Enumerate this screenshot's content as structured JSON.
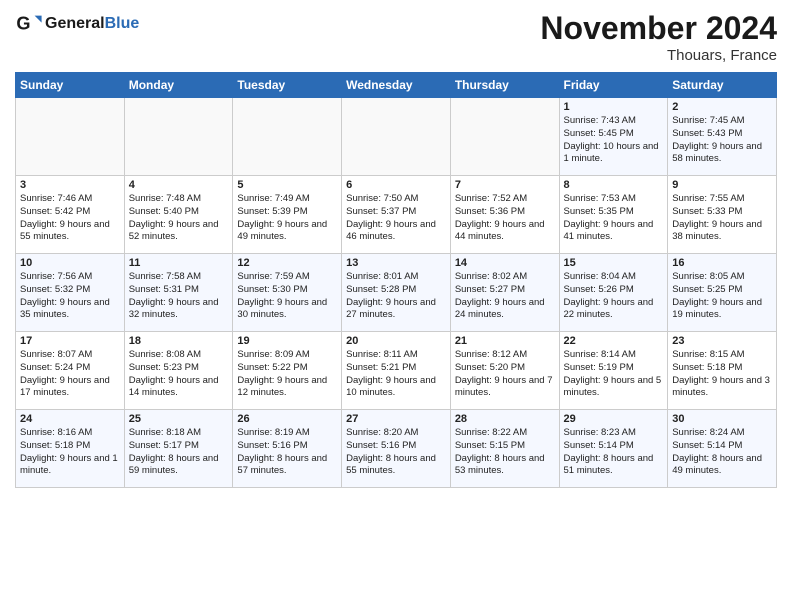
{
  "logo": {
    "text_general": "General",
    "text_blue": "Blue"
  },
  "title": "November 2024",
  "location": "Thouars, France",
  "days_of_week": [
    "Sunday",
    "Monday",
    "Tuesday",
    "Wednesday",
    "Thursday",
    "Friday",
    "Saturday"
  ],
  "weeks": [
    [
      {
        "day": "",
        "sunrise": "",
        "sunset": "",
        "daylight": ""
      },
      {
        "day": "",
        "sunrise": "",
        "sunset": "",
        "daylight": ""
      },
      {
        "day": "",
        "sunrise": "",
        "sunset": "",
        "daylight": ""
      },
      {
        "day": "",
        "sunrise": "",
        "sunset": "",
        "daylight": ""
      },
      {
        "day": "",
        "sunrise": "",
        "sunset": "",
        "daylight": ""
      },
      {
        "day": "1",
        "sunrise": "Sunrise: 7:43 AM",
        "sunset": "Sunset: 5:45 PM",
        "daylight": "Daylight: 10 hours and 1 minute."
      },
      {
        "day": "2",
        "sunrise": "Sunrise: 7:45 AM",
        "sunset": "Sunset: 5:43 PM",
        "daylight": "Daylight: 9 hours and 58 minutes."
      }
    ],
    [
      {
        "day": "3",
        "sunrise": "Sunrise: 7:46 AM",
        "sunset": "Sunset: 5:42 PM",
        "daylight": "Daylight: 9 hours and 55 minutes."
      },
      {
        "day": "4",
        "sunrise": "Sunrise: 7:48 AM",
        "sunset": "Sunset: 5:40 PM",
        "daylight": "Daylight: 9 hours and 52 minutes."
      },
      {
        "day": "5",
        "sunrise": "Sunrise: 7:49 AM",
        "sunset": "Sunset: 5:39 PM",
        "daylight": "Daylight: 9 hours and 49 minutes."
      },
      {
        "day": "6",
        "sunrise": "Sunrise: 7:50 AM",
        "sunset": "Sunset: 5:37 PM",
        "daylight": "Daylight: 9 hours and 46 minutes."
      },
      {
        "day": "7",
        "sunrise": "Sunrise: 7:52 AM",
        "sunset": "Sunset: 5:36 PM",
        "daylight": "Daylight: 9 hours and 44 minutes."
      },
      {
        "day": "8",
        "sunrise": "Sunrise: 7:53 AM",
        "sunset": "Sunset: 5:35 PM",
        "daylight": "Daylight: 9 hours and 41 minutes."
      },
      {
        "day": "9",
        "sunrise": "Sunrise: 7:55 AM",
        "sunset": "Sunset: 5:33 PM",
        "daylight": "Daylight: 9 hours and 38 minutes."
      }
    ],
    [
      {
        "day": "10",
        "sunrise": "Sunrise: 7:56 AM",
        "sunset": "Sunset: 5:32 PM",
        "daylight": "Daylight: 9 hours and 35 minutes."
      },
      {
        "day": "11",
        "sunrise": "Sunrise: 7:58 AM",
        "sunset": "Sunset: 5:31 PM",
        "daylight": "Daylight: 9 hours and 32 minutes."
      },
      {
        "day": "12",
        "sunrise": "Sunrise: 7:59 AM",
        "sunset": "Sunset: 5:30 PM",
        "daylight": "Daylight: 9 hours and 30 minutes."
      },
      {
        "day": "13",
        "sunrise": "Sunrise: 8:01 AM",
        "sunset": "Sunset: 5:28 PM",
        "daylight": "Daylight: 9 hours and 27 minutes."
      },
      {
        "day": "14",
        "sunrise": "Sunrise: 8:02 AM",
        "sunset": "Sunset: 5:27 PM",
        "daylight": "Daylight: 9 hours and 24 minutes."
      },
      {
        "day": "15",
        "sunrise": "Sunrise: 8:04 AM",
        "sunset": "Sunset: 5:26 PM",
        "daylight": "Daylight: 9 hours and 22 minutes."
      },
      {
        "day": "16",
        "sunrise": "Sunrise: 8:05 AM",
        "sunset": "Sunset: 5:25 PM",
        "daylight": "Daylight: 9 hours and 19 minutes."
      }
    ],
    [
      {
        "day": "17",
        "sunrise": "Sunrise: 8:07 AM",
        "sunset": "Sunset: 5:24 PM",
        "daylight": "Daylight: 9 hours and 17 minutes."
      },
      {
        "day": "18",
        "sunrise": "Sunrise: 8:08 AM",
        "sunset": "Sunset: 5:23 PM",
        "daylight": "Daylight: 9 hours and 14 minutes."
      },
      {
        "day": "19",
        "sunrise": "Sunrise: 8:09 AM",
        "sunset": "Sunset: 5:22 PM",
        "daylight": "Daylight: 9 hours and 12 minutes."
      },
      {
        "day": "20",
        "sunrise": "Sunrise: 8:11 AM",
        "sunset": "Sunset: 5:21 PM",
        "daylight": "Daylight: 9 hours and 10 minutes."
      },
      {
        "day": "21",
        "sunrise": "Sunrise: 8:12 AM",
        "sunset": "Sunset: 5:20 PM",
        "daylight": "Daylight: 9 hours and 7 minutes."
      },
      {
        "day": "22",
        "sunrise": "Sunrise: 8:14 AM",
        "sunset": "Sunset: 5:19 PM",
        "daylight": "Daylight: 9 hours and 5 minutes."
      },
      {
        "day": "23",
        "sunrise": "Sunrise: 8:15 AM",
        "sunset": "Sunset: 5:18 PM",
        "daylight": "Daylight: 9 hours and 3 minutes."
      }
    ],
    [
      {
        "day": "24",
        "sunrise": "Sunrise: 8:16 AM",
        "sunset": "Sunset: 5:18 PM",
        "daylight": "Daylight: 9 hours and 1 minute."
      },
      {
        "day": "25",
        "sunrise": "Sunrise: 8:18 AM",
        "sunset": "Sunset: 5:17 PM",
        "daylight": "Daylight: 8 hours and 59 minutes."
      },
      {
        "day": "26",
        "sunrise": "Sunrise: 8:19 AM",
        "sunset": "Sunset: 5:16 PM",
        "daylight": "Daylight: 8 hours and 57 minutes."
      },
      {
        "day": "27",
        "sunrise": "Sunrise: 8:20 AM",
        "sunset": "Sunset: 5:16 PM",
        "daylight": "Daylight: 8 hours and 55 minutes."
      },
      {
        "day": "28",
        "sunrise": "Sunrise: 8:22 AM",
        "sunset": "Sunset: 5:15 PM",
        "daylight": "Daylight: 8 hours and 53 minutes."
      },
      {
        "day": "29",
        "sunrise": "Sunrise: 8:23 AM",
        "sunset": "Sunset: 5:14 PM",
        "daylight": "Daylight: 8 hours and 51 minutes."
      },
      {
        "day": "30",
        "sunrise": "Sunrise: 8:24 AM",
        "sunset": "Sunset: 5:14 PM",
        "daylight": "Daylight: 8 hours and 49 minutes."
      }
    ]
  ]
}
